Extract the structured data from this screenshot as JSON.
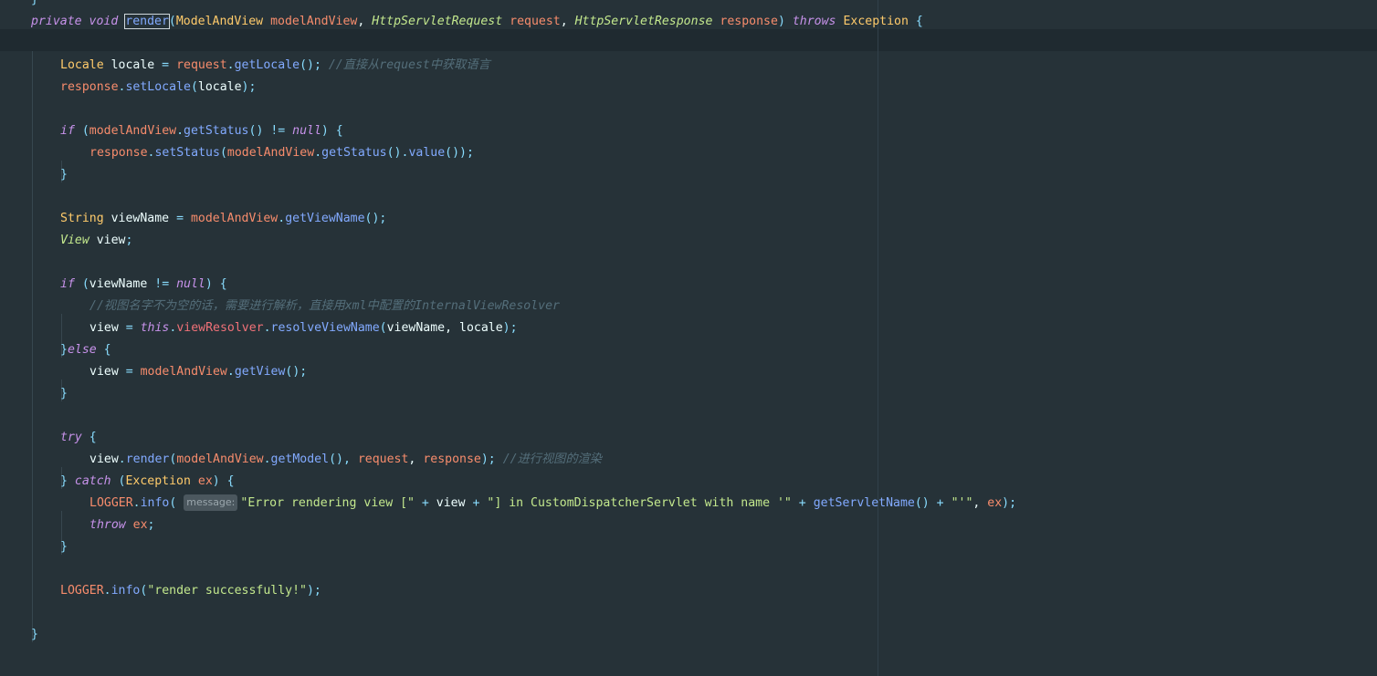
{
  "code_lines": [
    {
      "indent": 0,
      "tokens": [
        {
          "t": "}",
          "c": "punc"
        }
      ]
    },
    {
      "indent": 0,
      "tokens": [
        {
          "t": "private",
          "c": "kw"
        },
        {
          "t": " "
        },
        {
          "t": "void",
          "c": "kw"
        },
        {
          "t": " "
        },
        {
          "t": "render",
          "c": "fn",
          "hl": true
        },
        {
          "t": "(",
          "c": "punc"
        },
        {
          "t": "ModelAndView",
          "c": "type"
        },
        {
          "t": " "
        },
        {
          "t": "modelAndView",
          "c": "param"
        },
        {
          "t": ", ",
          "c": "local"
        },
        {
          "t": "HttpServletRequest",
          "c": "itype"
        },
        {
          "t": " "
        },
        {
          "t": "request",
          "c": "param"
        },
        {
          "t": ", ",
          "c": "local"
        },
        {
          "t": "HttpServletResponse",
          "c": "itype"
        },
        {
          "t": " "
        },
        {
          "t": "response",
          "c": "param"
        },
        {
          "t": ")",
          "c": "punc"
        },
        {
          "t": " "
        },
        {
          "t": "throws",
          "c": "kw"
        },
        {
          "t": " "
        },
        {
          "t": "Exception",
          "c": "type"
        },
        {
          "t": " "
        },
        {
          "t": "{",
          "c": "punc"
        }
      ]
    },
    {
      "indent": 0,
      "tokens": []
    },
    {
      "indent": 1,
      "tokens": [
        {
          "t": "Locale",
          "c": "type"
        },
        {
          "t": " "
        },
        {
          "t": "locale",
          "c": "local"
        },
        {
          "t": " = ",
          "c": "punc"
        },
        {
          "t": "request",
          "c": "param"
        },
        {
          "t": ".",
          "c": "punc"
        },
        {
          "t": "getLocale",
          "c": "fn"
        },
        {
          "t": "();",
          "c": "punc"
        },
        {
          "t": " "
        },
        {
          "t": "//直接从request中获取语言",
          "c": "cmt"
        }
      ]
    },
    {
      "indent": 1,
      "tokens": [
        {
          "t": "response",
          "c": "param"
        },
        {
          "t": ".",
          "c": "punc"
        },
        {
          "t": "setLocale",
          "c": "fn"
        },
        {
          "t": "(",
          "c": "punc"
        },
        {
          "t": "locale",
          "c": "local"
        },
        {
          "t": ");",
          "c": "punc"
        }
      ]
    },
    {
      "indent": 0,
      "tokens": []
    },
    {
      "indent": 1,
      "tokens": [
        {
          "t": "if",
          "c": "kw"
        },
        {
          "t": " "
        },
        {
          "t": "(",
          "c": "punc"
        },
        {
          "t": "modelAndView",
          "c": "param"
        },
        {
          "t": ".",
          "c": "punc"
        },
        {
          "t": "getStatus",
          "c": "fn"
        },
        {
          "t": "()",
          "c": "punc"
        },
        {
          "t": " != ",
          "c": "punc"
        },
        {
          "t": "null",
          "c": "kw"
        },
        {
          "t": ") {",
          "c": "punc"
        }
      ]
    },
    {
      "indent": 2,
      "tokens": [
        {
          "t": "response",
          "c": "param"
        },
        {
          "t": ".",
          "c": "punc"
        },
        {
          "t": "setStatus",
          "c": "fn"
        },
        {
          "t": "(",
          "c": "punc"
        },
        {
          "t": "modelAndView",
          "c": "param"
        },
        {
          "t": ".",
          "c": "punc"
        },
        {
          "t": "getStatus",
          "c": "fn"
        },
        {
          "t": "().",
          "c": "punc"
        },
        {
          "t": "value",
          "c": "fn"
        },
        {
          "t": "());",
          "c": "punc"
        }
      ]
    },
    {
      "indent": 1,
      "tokens": [
        {
          "t": "}",
          "c": "punc"
        }
      ]
    },
    {
      "indent": 0,
      "tokens": []
    },
    {
      "indent": 1,
      "tokens": [
        {
          "t": "String",
          "c": "type"
        },
        {
          "t": " "
        },
        {
          "t": "viewName",
          "c": "local"
        },
        {
          "t": " = ",
          "c": "punc"
        },
        {
          "t": "modelAndView",
          "c": "param"
        },
        {
          "t": ".",
          "c": "punc"
        },
        {
          "t": "getViewName",
          "c": "fn"
        },
        {
          "t": "();",
          "c": "punc"
        }
      ]
    },
    {
      "indent": 1,
      "tokens": [
        {
          "t": "View",
          "c": "itype"
        },
        {
          "t": " "
        },
        {
          "t": "view",
          "c": "local"
        },
        {
          "t": ";",
          "c": "punc"
        }
      ]
    },
    {
      "indent": 0,
      "tokens": []
    },
    {
      "indent": 1,
      "tokens": [
        {
          "t": "if",
          "c": "kw"
        },
        {
          "t": " "
        },
        {
          "t": "(",
          "c": "punc"
        },
        {
          "t": "viewName",
          "c": "local"
        },
        {
          "t": " != ",
          "c": "punc"
        },
        {
          "t": "null",
          "c": "kw"
        },
        {
          "t": ") {",
          "c": "punc"
        }
      ]
    },
    {
      "indent": 2,
      "tokens": [
        {
          "t": "//视图名字不为空的话，需要进行解析，直接用xml中配置的InternalViewResolver",
          "c": "cmt"
        }
      ]
    },
    {
      "indent": 2,
      "tokens": [
        {
          "t": "view",
          "c": "local"
        },
        {
          "t": " = ",
          "c": "punc"
        },
        {
          "t": "this",
          "c": "kw"
        },
        {
          "t": ".",
          "c": "punc"
        },
        {
          "t": "viewResolver",
          "c": "field"
        },
        {
          "t": ".",
          "c": "punc"
        },
        {
          "t": "resolveViewName",
          "c": "fn"
        },
        {
          "t": "(",
          "c": "punc"
        },
        {
          "t": "viewName",
          "c": "local"
        },
        {
          "t": ", ",
          "c": "local"
        },
        {
          "t": "locale",
          "c": "local"
        },
        {
          "t": ");",
          "c": "punc"
        }
      ]
    },
    {
      "indent": 1,
      "tokens": [
        {
          "t": "}",
          "c": "punc"
        },
        {
          "t": "else",
          "c": "kw"
        },
        {
          "t": " {",
          "c": "punc"
        }
      ]
    },
    {
      "indent": 2,
      "tokens": [
        {
          "t": "view",
          "c": "local"
        },
        {
          "t": " = ",
          "c": "punc"
        },
        {
          "t": "modelAndView",
          "c": "param"
        },
        {
          "t": ".",
          "c": "punc"
        },
        {
          "t": "getView",
          "c": "fn"
        },
        {
          "t": "();",
          "c": "punc"
        }
      ]
    },
    {
      "indent": 1,
      "tokens": [
        {
          "t": "}",
          "c": "punc"
        }
      ]
    },
    {
      "indent": 0,
      "tokens": []
    },
    {
      "indent": 1,
      "tokens": [
        {
          "t": "try",
          "c": "kw"
        },
        {
          "t": " {",
          "c": "punc"
        }
      ]
    },
    {
      "indent": 2,
      "tokens": [
        {
          "t": "view",
          "c": "local"
        },
        {
          "t": ".",
          "c": "punc"
        },
        {
          "t": "render",
          "c": "fn"
        },
        {
          "t": "(",
          "c": "punc"
        },
        {
          "t": "modelAndView",
          "c": "param"
        },
        {
          "t": ".",
          "c": "punc"
        },
        {
          "t": "getModel",
          "c": "fn"
        },
        {
          "t": "(), ",
          "c": "punc"
        },
        {
          "t": "request",
          "c": "param"
        },
        {
          "t": ", ",
          "c": "local"
        },
        {
          "t": "response",
          "c": "param"
        },
        {
          "t": ");",
          "c": "punc"
        },
        {
          "t": " "
        },
        {
          "t": "//进行视图的渲染",
          "c": "cmt"
        }
      ]
    },
    {
      "indent": 1,
      "tokens": [
        {
          "t": "} ",
          "c": "punc"
        },
        {
          "t": "catch",
          "c": "kw"
        },
        {
          "t": " (",
          "c": "punc"
        },
        {
          "t": "Exception",
          "c": "type"
        },
        {
          "t": " "
        },
        {
          "t": "ex",
          "c": "param"
        },
        {
          "t": ") {",
          "c": "punc"
        }
      ]
    },
    {
      "indent": 2,
      "tokens": [
        {
          "t": "LOGGER",
          "c": "param"
        },
        {
          "t": ".",
          "c": "punc"
        },
        {
          "t": "info",
          "c": "fn"
        },
        {
          "t": "( ",
          "c": "punc"
        },
        {
          "t": "message:",
          "c": "hint"
        },
        {
          "t": "\"Error rendering view [\"",
          "c": "str"
        },
        {
          "t": " + ",
          "c": "punc"
        },
        {
          "t": "view",
          "c": "local"
        },
        {
          "t": " + ",
          "c": "punc"
        },
        {
          "t": "\"] in CustomDispatcherServlet with name '\"",
          "c": "str"
        },
        {
          "t": " + ",
          "c": "punc"
        },
        {
          "t": "getServletName",
          "c": "fn"
        },
        {
          "t": "()",
          "c": "punc"
        },
        {
          "t": " + ",
          "c": "punc"
        },
        {
          "t": "\"'\"",
          "c": "str"
        },
        {
          "t": ", ",
          "c": "local"
        },
        {
          "t": "ex",
          "c": "param"
        },
        {
          "t": ");",
          "c": "punc"
        }
      ]
    },
    {
      "indent": 2,
      "tokens": [
        {
          "t": "throw",
          "c": "kw"
        },
        {
          "t": " "
        },
        {
          "t": "ex",
          "c": "param"
        },
        {
          "t": ";",
          "c": "punc"
        }
      ]
    },
    {
      "indent": 1,
      "tokens": [
        {
          "t": "}",
          "c": "punc"
        }
      ]
    },
    {
      "indent": 0,
      "tokens": []
    },
    {
      "indent": 1,
      "tokens": [
        {
          "t": "LOGGER",
          "c": "param"
        },
        {
          "t": ".",
          "c": "punc"
        },
        {
          "t": "info",
          "c": "fn"
        },
        {
          "t": "(",
          "c": "punc"
        },
        {
          "t": "\"render successfully!\"",
          "c": "str"
        },
        {
          "t": ");",
          "c": "punc"
        }
      ]
    },
    {
      "indent": 0,
      "tokens": []
    },
    {
      "indent": 0,
      "tokens": [
        {
          "t": "}",
          "c": "punc"
        }
      ]
    }
  ],
  "theme": {
    "background": "#263238",
    "current_line": "#1f2a30",
    "keyword": "#c792ea",
    "type": "#ffcb6b",
    "string": "#c3e88d",
    "comment": "#546e7a",
    "function": "#82aaff",
    "parameter": "#f78c6c",
    "field": "#f07178"
  }
}
